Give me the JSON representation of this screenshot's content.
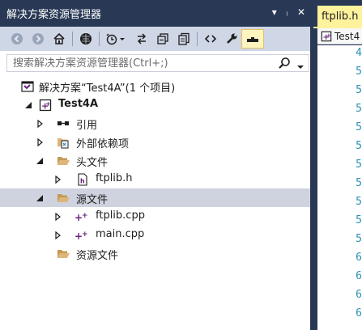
{
  "colors": {
    "frame": "#293955",
    "toolbar": "#cfd6e5",
    "selection": "#cfd3df",
    "tab_active": "#fff29d",
    "line_numbers": "#2b91af"
  },
  "window": {
    "title": "解决方案资源管理器",
    "buttons": [
      "▾",
      "ᛧ",
      "✕"
    ]
  },
  "toolbar": {
    "buttons": [
      "back-icon",
      "forward-icon",
      "home-icon",
      "vs-icon",
      "history-icon",
      "sync-icon",
      "collapse-all-icon",
      "copy-icon",
      "code-view-icon",
      "properties-icon",
      "preview-icon"
    ]
  },
  "search": {
    "placeholder": "搜索解决方案资源管理器(Ctrl+;)"
  },
  "tree": {
    "solution": "解决方案“Test4A”(1 个项目)",
    "project": "Test4A",
    "references": "引用",
    "external": "外部依赖项",
    "headers": "头文件",
    "ftplib_h": "ftplib.h",
    "sources": "源文件",
    "ftplib_cpp": "ftplib.cpp",
    "main_cpp": "main.cpp",
    "resources": "资源文件"
  },
  "editor": {
    "tab": "ftplib.h",
    "nav": "Test4",
    "line_numbers": [
      "4",
      "5",
      "5",
      "5",
      "5",
      "5",
      "5",
      "5",
      "5",
      "5",
      "5",
      "6",
      "6",
      "6",
      "6"
    ]
  }
}
